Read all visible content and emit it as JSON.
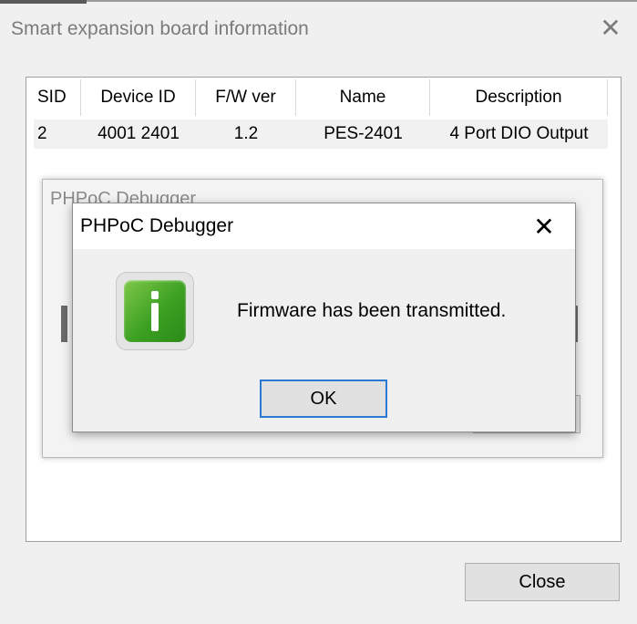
{
  "window": {
    "title": "Smart expansion board information",
    "close_glyph": "✕"
  },
  "table": {
    "headers": [
      "SID",
      "Device ID",
      "F/W ver",
      "Name",
      "Description"
    ],
    "rows": [
      [
        "2",
        "4001 2401",
        "1.2",
        "PES-2401",
        "4 Port DIO Output"
      ]
    ]
  },
  "background_dialog": {
    "title": "PHPoC Debugger"
  },
  "message_box": {
    "title": "PHPoC Debugger",
    "close_glyph": "✕",
    "icon": "info-icon",
    "message": "Firmware has been transmitted.",
    "ok_label": "OK"
  },
  "footer": {
    "close_label": "Close"
  },
  "colors": {
    "accent_border": "#2a7ad2",
    "icon_green": "#3da022"
  }
}
